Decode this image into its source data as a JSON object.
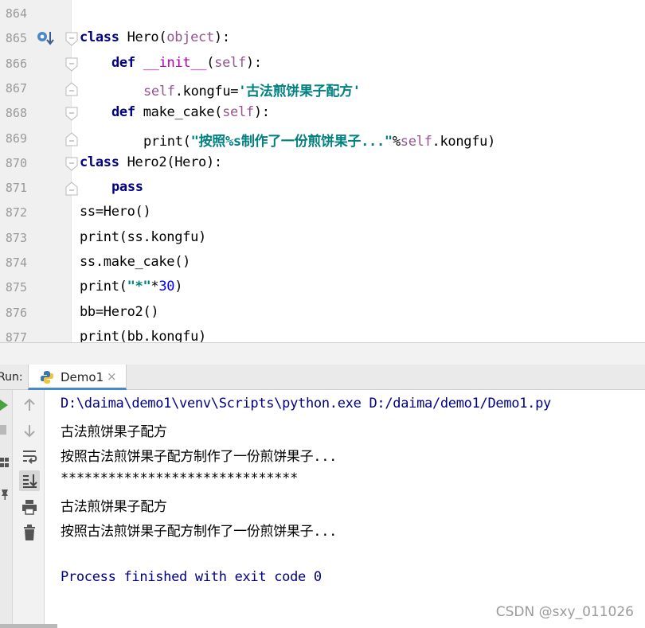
{
  "editor": {
    "lines": [
      {
        "num": "864",
        "indent": 0,
        "tokens": []
      },
      {
        "num": "865",
        "indent": 0,
        "tokens": [
          {
            "t": "class",
            "c": "kw"
          },
          {
            "t": " Hero(",
            "c": ""
          },
          {
            "t": "object",
            "c": "kw2"
          },
          {
            "t": "):",
            "c": ""
          }
        ]
      },
      {
        "num": "866",
        "indent": 1,
        "tokens": [
          {
            "t": "def",
            "c": "kw"
          },
          {
            "t": " ",
            "c": ""
          },
          {
            "t": "__init__",
            "c": "magic"
          },
          {
            "t": "(",
            "c": ""
          },
          {
            "t": "self",
            "c": "self"
          },
          {
            "t": "):",
            "c": ""
          }
        ]
      },
      {
        "num": "867",
        "indent": 2,
        "tokens": [
          {
            "t": "self",
            "c": "self"
          },
          {
            "t": ".kongfu=",
            "c": ""
          },
          {
            "t": "'古法煎饼果子配方'",
            "c": "str"
          }
        ]
      },
      {
        "num": "868",
        "indent": 1,
        "tokens": [
          {
            "t": "def",
            "c": "kw"
          },
          {
            "t": " make_cake(",
            "c": ""
          },
          {
            "t": "self",
            "c": "self"
          },
          {
            "t": "):",
            "c": ""
          }
        ]
      },
      {
        "num": "869",
        "indent": 2,
        "tokens": [
          {
            "t": "print(",
            "c": ""
          },
          {
            "t": "\"按照%s制作了一份煎饼果子...\"",
            "c": "str"
          },
          {
            "t": "%",
            "c": ""
          },
          {
            "t": "self",
            "c": "self"
          },
          {
            "t": ".kongfu)",
            "c": ""
          }
        ]
      },
      {
        "num": "870",
        "indent": 0,
        "tokens": [
          {
            "t": "class",
            "c": "kw"
          },
          {
            "t": " Hero2(Hero):",
            "c": ""
          }
        ]
      },
      {
        "num": "871",
        "indent": 1,
        "tokens": [
          {
            "t": "pass",
            "c": "kw"
          }
        ]
      },
      {
        "num": "872",
        "indent": 0,
        "tokens": [
          {
            "t": "ss=Hero()",
            "c": ""
          }
        ]
      },
      {
        "num": "873",
        "indent": 0,
        "tokens": [
          {
            "t": "print(ss.kongfu)",
            "c": ""
          }
        ]
      },
      {
        "num": "874",
        "indent": 0,
        "tokens": [
          {
            "t": "ss.make_cake()",
            "c": ""
          }
        ]
      },
      {
        "num": "875",
        "indent": 0,
        "tokens": [
          {
            "t": "print(",
            "c": ""
          },
          {
            "t": "\"*\"",
            "c": "str"
          },
          {
            "t": "*",
            "c": ""
          },
          {
            "t": "30",
            "c": "num"
          },
          {
            "t": ")",
            "c": ""
          }
        ]
      },
      {
        "num": "876",
        "indent": 0,
        "tokens": [
          {
            "t": "bb=Hero2()",
            "c": ""
          }
        ]
      },
      {
        "num": "877",
        "indent": 0,
        "tokens": [
          {
            "t": "print(bb.kongfu)",
            "c": ""
          }
        ]
      }
    ]
  },
  "run": {
    "label": "Run:",
    "tab_label": "Demo1",
    "tab_close": "×"
  },
  "console": {
    "lines": [
      {
        "text": "D:\\daima\\demo1\\venv\\Scripts\\python.exe D:/daima/demo1/Demo1.py",
        "style": "blue"
      },
      {
        "text": "古法煎饼果子配方",
        "style": "black"
      },
      {
        "text": "按照古法煎饼果子配方制作了一份煎饼果子...",
        "style": "black"
      },
      {
        "text": "******************************",
        "style": "black"
      },
      {
        "text": "古法煎饼果子配方",
        "style": "black"
      },
      {
        "text": "按照古法煎饼果子配方制作了一份煎饼果子...",
        "style": "black"
      },
      {
        "text": "",
        "style": "black"
      },
      {
        "text": "Process finished with exit code 0",
        "style": "blue"
      }
    ]
  },
  "watermark": "CSDN @sxy_011026",
  "colors": {
    "keyword": "#000080",
    "self": "#94558d",
    "string": "#008080",
    "number": "#0000ff",
    "magic": "#b200b2",
    "accent": "#4a88c7"
  }
}
